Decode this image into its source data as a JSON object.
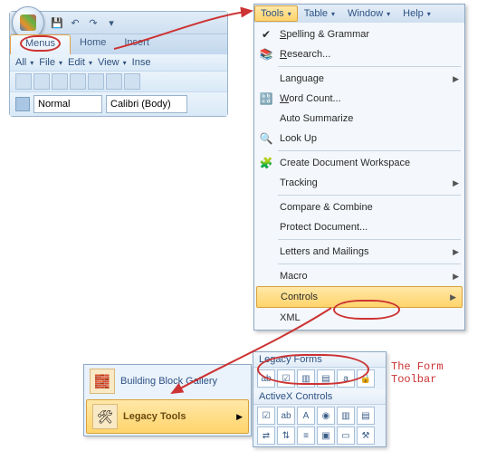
{
  "ribbon": {
    "tabs": {
      "menus": "Menus",
      "home": "Home",
      "insert": "Insert"
    },
    "toolbar": {
      "all": "All",
      "file": "File",
      "edit": "Edit",
      "view": "View",
      "insert": "Inse"
    },
    "fmt": {
      "style": "Normal",
      "font": "Calibri (Body)"
    }
  },
  "menubar": {
    "tools": "Tools",
    "table": "Table",
    "window": "Window",
    "help": "Help"
  },
  "menu": {
    "spelling": "Spelling & Grammar",
    "research": "Research...",
    "language": "Language",
    "wordcount": "Word Count...",
    "autosum": "Auto Summarize",
    "lookup": "Look Up",
    "docws": "Create Document Workspace",
    "tracking": "Tracking",
    "compare": "Compare & Combine",
    "protect": "Protect Document...",
    "letters": "Letters and Mailings",
    "macro": "Macro",
    "controls": "Controls",
    "xml": "XML"
  },
  "popup1": {
    "bbg": "Building Block Gallery",
    "legacy": "Legacy Tools"
  },
  "palette": {
    "legacyforms": "Legacy Forms",
    "activex": "ActiveX Controls"
  },
  "note": "The Form Toolbar"
}
